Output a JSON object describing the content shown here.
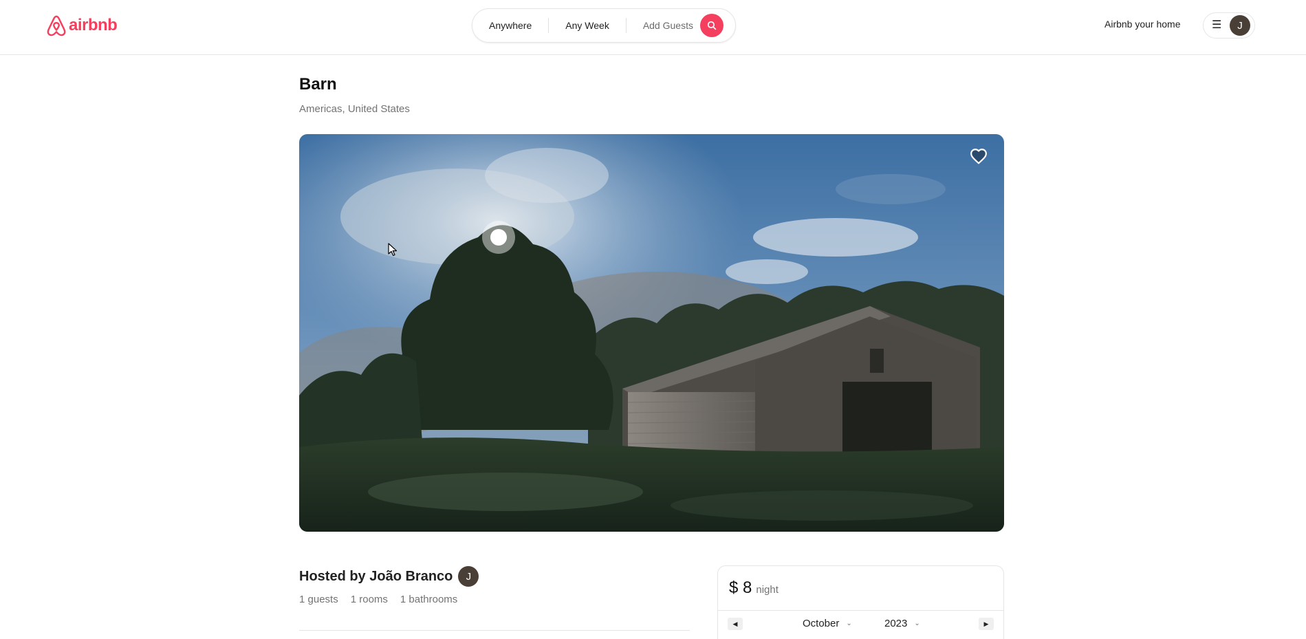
{
  "navbar": {
    "logo_text": "airbnb",
    "brand_color": "#f43f5e",
    "search": {
      "where": "Anywhere",
      "when": "Any Week",
      "guests": "Add Guests"
    },
    "host_link": "Airbnb your home",
    "avatar_initial": "J"
  },
  "listing": {
    "title": "Barn",
    "location": "Americas, United States",
    "hosted_by": "Hosted by João Branco",
    "host_initial": "J",
    "stats": {
      "guests": "1 guests",
      "rooms": "1 rooms",
      "bathrooms": "1 bathrooms"
    }
  },
  "reservation": {
    "price": "$ 8",
    "unit": "night",
    "calendar": {
      "month": "October",
      "year": "2023"
    }
  }
}
